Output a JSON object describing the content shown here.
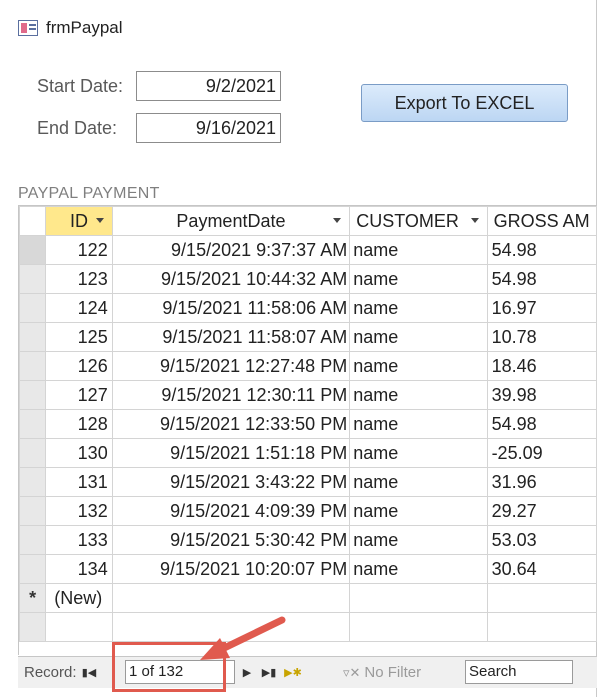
{
  "form": {
    "icon": "form-icon",
    "title": "frmPaypal"
  },
  "filters": {
    "start_label": "Start Date:",
    "start_value": "9/2/2021",
    "end_label": "End Date:",
    "end_value": "9/16/2021"
  },
  "export_button": "Export To EXCEL",
  "subform": {
    "title": "PAYPAL PAYMENT",
    "columns": [
      "ID",
      "PaymentDate",
      "CUSTOMER",
      "GROSS AM"
    ],
    "rows": [
      [
        "122",
        "9/15/2021 9:37:37 AM",
        "name",
        "54.98"
      ],
      [
        "123",
        "9/15/2021 10:44:32 AM",
        "name",
        "54.98"
      ],
      [
        "124",
        "9/15/2021 11:58:06 AM",
        "name",
        "16.97"
      ],
      [
        "125",
        "9/15/2021 11:58:07 AM",
        "name",
        "10.78"
      ],
      [
        "126",
        "9/15/2021 12:27:48 PM",
        "name",
        "18.46"
      ],
      [
        "127",
        "9/15/2021 12:30:11 PM",
        "name",
        "39.98"
      ],
      [
        "128",
        "9/15/2021 12:33:50 PM",
        "name",
        "54.98"
      ],
      [
        "130",
        "9/15/2021 1:51:18 PM",
        "name",
        "-25.09"
      ],
      [
        "131",
        "9/15/2021 3:43:22 PM",
        "name",
        "31.96"
      ],
      [
        "132",
        "9/15/2021 4:09:39 PM",
        "name",
        "29.27"
      ],
      [
        "133",
        "9/15/2021 5:30:42 PM",
        "name",
        "53.03"
      ],
      [
        "134",
        "9/15/2021 10:20:07 PM",
        "name",
        "30.64"
      ]
    ],
    "new_row_marker": "*",
    "new_row_label": "(New)"
  },
  "navigation": {
    "record_label": "Record:",
    "current_position": "1 of 132",
    "filter_label": "No Filter",
    "search_placeholder": "Search",
    "first_icon": "first-record-icon",
    "prev_icon": "previous-record-icon",
    "next_icon": "next-record-icon",
    "last_icon": "last-record-icon",
    "new_icon": "new-record-icon",
    "filter_icon": "filter-off-icon"
  },
  "annotation": {
    "color": "#e05a4e"
  },
  "colors": {
    "id_header": "#ffe88c",
    "button": "#bcd6f3"
  }
}
